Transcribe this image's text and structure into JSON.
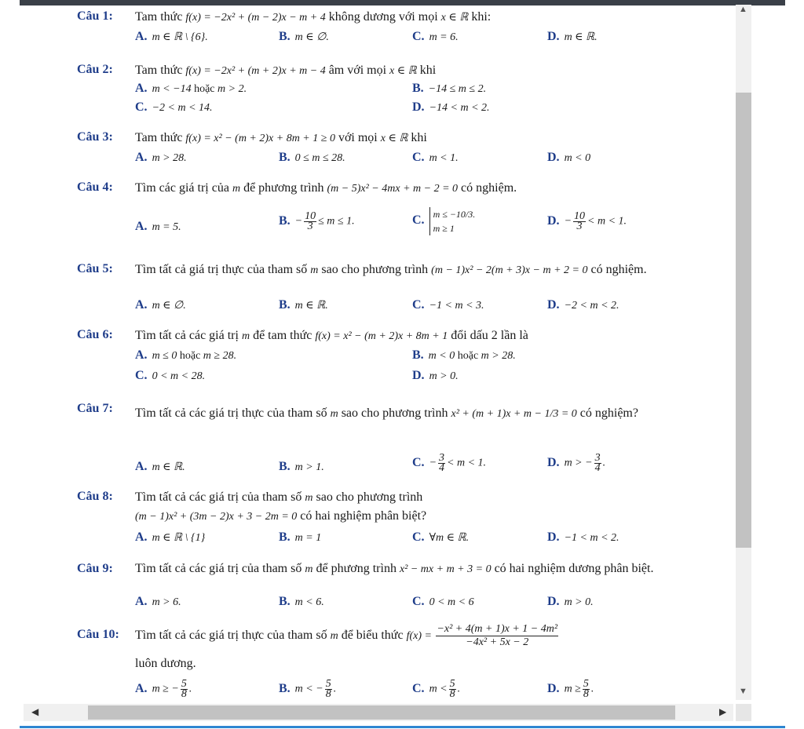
{
  "questions": [
    {
      "label": "Câu 1:",
      "stem": [
        "Tam thức ",
        "f(x) = −2x² + (m − 2)x − m + 4",
        " không dương với mọi ",
        "x ∈ ℝ",
        " khi:"
      ],
      "options": [
        {
          "letter": "A.",
          "text": "m ∈ ℝ \\ {6}."
        },
        {
          "letter": "B.",
          "text": "m ∈ ∅."
        },
        {
          "letter": "C.",
          "text": "m = 6."
        },
        {
          "letter": "D.",
          "text": "m ∈ ℝ."
        }
      ]
    },
    {
      "label": "Câu 2:",
      "stem": [
        "Tam thức ",
        "f(x) = −2x² + (m + 2)x + m − 4",
        " âm với mọi ",
        "x ∈ ℝ",
        " khi"
      ],
      "options": [
        {
          "letter": "A.",
          "text": "m < −14",
          "extra": " hoặc ",
          "text2": "m > 2."
        },
        {
          "letter": "B.",
          "text": "−14 ≤ m ≤ 2."
        },
        {
          "letter": "C.",
          "text": "−2 < m < 14."
        },
        {
          "letter": "D.",
          "text": "−14 < m < 2."
        }
      ]
    },
    {
      "label": "Câu 3:",
      "stem": [
        "Tam thức ",
        "f(x) = x² − (m + 2)x + 8m + 1 ≥ 0",
        " với mọi ",
        "x ∈ ℝ",
        " khi"
      ],
      "options": [
        {
          "letter": "A.",
          "text": "m > 28."
        },
        {
          "letter": "B.",
          "text": "0 ≤ m ≤ 28."
        },
        {
          "letter": "C.",
          "text": "m < 1."
        },
        {
          "letter": "D.",
          "text": "m < 0"
        }
      ]
    },
    {
      "label": "Câu 4:",
      "stem": [
        "Tìm các giá trị của ",
        "m",
        " để phương trình ",
        "(m − 5)x² − 4mx + m − 2 = 0",
        " có nghiệm."
      ],
      "options": [
        {
          "letter": "A.",
          "text": "m = 5."
        },
        {
          "letter": "B.",
          "pre": "−",
          "num": "10",
          "den": "3",
          "post": "≤ m ≤ 1."
        },
        {
          "letter": "C.",
          "sys1": "m ≤ −10/3.",
          "sys2": "m ≥ 1"
        },
        {
          "letter": "D.",
          "pre": "−",
          "num": "10",
          "den": "3",
          "post": "< m < 1."
        }
      ]
    },
    {
      "label": "Câu 5:",
      "stem": [
        "Tìm tất cả giá trị thực của tham số ",
        "m",
        " sao cho phương trình ",
        "(m − 1)x² − 2(m + 3)x − m + 2 = 0",
        " có nghiệm."
      ],
      "options": [
        {
          "letter": "A.",
          "text": "m ∈ ∅."
        },
        {
          "letter": "B.",
          "text": "m ∈ ℝ."
        },
        {
          "letter": "C.",
          "text": "−1 < m < 3."
        },
        {
          "letter": "D.",
          "text": "−2 < m < 2."
        }
      ]
    },
    {
      "label": "Câu 6:",
      "stem": [
        "Tìm tất cả các giá trị ",
        "m",
        " để tam thức ",
        "f(x) = x² − (m + 2)x + 8m + 1",
        " đổi dấu 2 lần là"
      ],
      "options": [
        {
          "letter": "A.",
          "text": "m ≤ 0",
          "extra": " hoặc ",
          "text2": "m ≥ 28."
        },
        {
          "letter": "B.",
          "text": "m < 0",
          "extra": " hoặc ",
          "text2": "m > 28."
        },
        {
          "letter": "C.",
          "text": "0 < m < 28."
        },
        {
          "letter": "D.",
          "text": "m > 0."
        }
      ]
    },
    {
      "label": "Câu 7:",
      "stem": [
        "Tìm tất cả các giá trị thực của tham số ",
        "m",
        " sao cho phương trình ",
        "x² + (m + 1)x + m − 1/3 = 0",
        " có nghiệm?"
      ],
      "options": [
        {
          "letter": "A.",
          "text": "m ∈ ℝ."
        },
        {
          "letter": "B.",
          "text": "m > 1."
        },
        {
          "letter": "C.",
          "pre": "−",
          "num": "3",
          "den": "4",
          "post": "< m < 1."
        },
        {
          "letter": "D.",
          "pre": "m > −",
          "num": "3",
          "den": "4",
          "post": "."
        }
      ]
    },
    {
      "label": "Câu 8:",
      "stem": [
        "Tìm tất cả các giá trị của tham số ",
        "m",
        " sao cho phương trình"
      ],
      "stem2": [
        "(m − 1)x² + (3m − 2)x + 3 − 2m = 0",
        " có hai nghiệm phân biệt?"
      ],
      "options": [
        {
          "letter": "A.",
          "text": "m ∈ ℝ \\ {1}"
        },
        {
          "letter": "B.",
          "text": "m = 1"
        },
        {
          "letter": "C.",
          "text": "∀m ∈ ℝ."
        },
        {
          "letter": "D.",
          "text": "−1 < m < 2."
        }
      ]
    },
    {
      "label": "Câu 9:",
      "stem": [
        "Tìm tất cả các giá trị của tham số ",
        "m",
        " để phương trình ",
        "x² − mx + m + 3 = 0",
        " có hai nghiệm dương phân biệt."
      ],
      "options": [
        {
          "letter": "A.",
          "text": "m > 6."
        },
        {
          "letter": "B.",
          "text": "m < 6."
        },
        {
          "letter": "C.",
          "text": "0 < m < 6"
        },
        {
          "letter": "D.",
          "text": "m > 0."
        }
      ]
    },
    {
      "label": "Câu 10:",
      "stem": [
        "Tìm tất cả các giá trị thực của tham số ",
        "m",
        " để biểu thức ",
        "f(x) = "
      ],
      "frac_num": "−x² + 4(m + 1)x + 1 − 4m²",
      "frac_den": "−4x² + 5x − 2",
      "stem2": [
        "luôn dương."
      ],
      "options": [
        {
          "letter": "A.",
          "pre": "m ≥ −",
          "num": "5",
          "den": "8",
          "post": "."
        },
        {
          "letter": "B.",
          "pre": "m < −",
          "num": "5",
          "den": "8",
          "post": "."
        },
        {
          "letter": "C.",
          "pre": "m <",
          "num": "5",
          "den": "8",
          "post": "."
        },
        {
          "letter": "D.",
          "pre": "m ≥",
          "num": "5",
          "den": "8",
          "post": "."
        }
      ]
    }
  ],
  "scrollbar": {
    "up": "▲",
    "down": "▼",
    "left": "◀",
    "right": "▶"
  }
}
